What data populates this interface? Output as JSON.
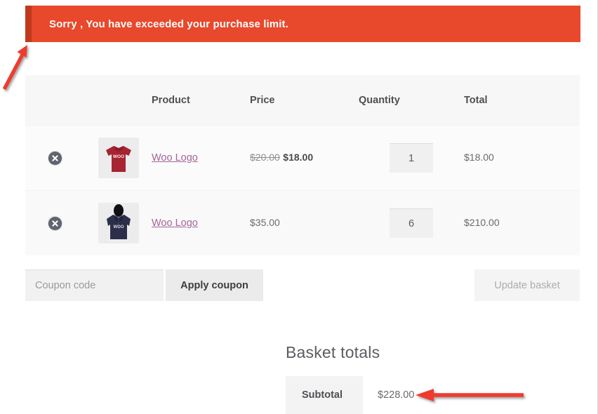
{
  "notice": {
    "message": "Sorry , You have exceeded your purchase limit.",
    "background_color": "#e8482b",
    "accent_color": "#bf3a1c",
    "icon": "error-notice"
  },
  "cart": {
    "columns": {
      "remove": "",
      "thumbnail": "",
      "product": "Product",
      "price": "Price",
      "quantity": "Quantity",
      "total": "Total"
    },
    "items": [
      {
        "remove_icon": "remove-item-icon",
        "thumbnail": "red-tshirt-woo-logo",
        "name": "Woo Logo",
        "price_old": "$20.00",
        "price_new": "$18.00",
        "price": "",
        "quantity": "1",
        "total": "$18.00"
      },
      {
        "remove_icon": "remove-item-icon",
        "thumbnail": "navy-hoodie-woo-logo",
        "name": "Woo Logo",
        "price_old": "",
        "price_new": "",
        "price": "$35.00",
        "quantity": "6",
        "total": "$210.00"
      }
    ]
  },
  "coupon": {
    "placeholder": "Coupon code",
    "value": "",
    "apply_label": "Apply coupon"
  },
  "actions": {
    "update_label": "Update basket"
  },
  "totals": {
    "title": "Basket totals",
    "rows": [
      {
        "label": "Subtotal",
        "value": "$228.00"
      }
    ]
  },
  "annotations": {
    "arrow_color": "#ee3b2f",
    "arrows": [
      {
        "name": "arrow-pointing-to-notice",
        "direction": "up-right"
      },
      {
        "name": "arrow-pointing-to-subtotal",
        "direction": "left"
      }
    ]
  },
  "product_link_color": "#a46497"
}
